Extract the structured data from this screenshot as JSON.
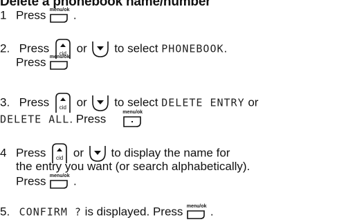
{
  "title": "Delete a phonebook name/number",
  "icons": {
    "menu_ok": "menu/ok",
    "up_cid": "cid"
  },
  "steps": [
    {
      "num": "1",
      "t1": "Press",
      "t2": "."
    },
    {
      "num": "2.",
      "t1": "Press",
      "t2": "or",
      "t3": "to select",
      "lcd1": "PHONEBOOK",
      "t4": ".",
      "l2_t1": "Press"
    },
    {
      "num": "3.",
      "t1": "Press",
      "t2": "or",
      "t3": "to select",
      "lcd1": "DELETE ENTRY",
      "t4": "or",
      "lcd2": "DELETE ALL",
      "t5": ". Press"
    },
    {
      "num": "4",
      "t1": "Press",
      "t2": "or",
      "t3": "to display the name for",
      "l2": "the entry you want (or search alphabetically).",
      "l3_t1": "Press",
      "l3_t2": "."
    },
    {
      "num": "5.",
      "lcd1": "CONFIRM ?",
      "t1": "is displayed. Press",
      "t2": "."
    }
  ]
}
